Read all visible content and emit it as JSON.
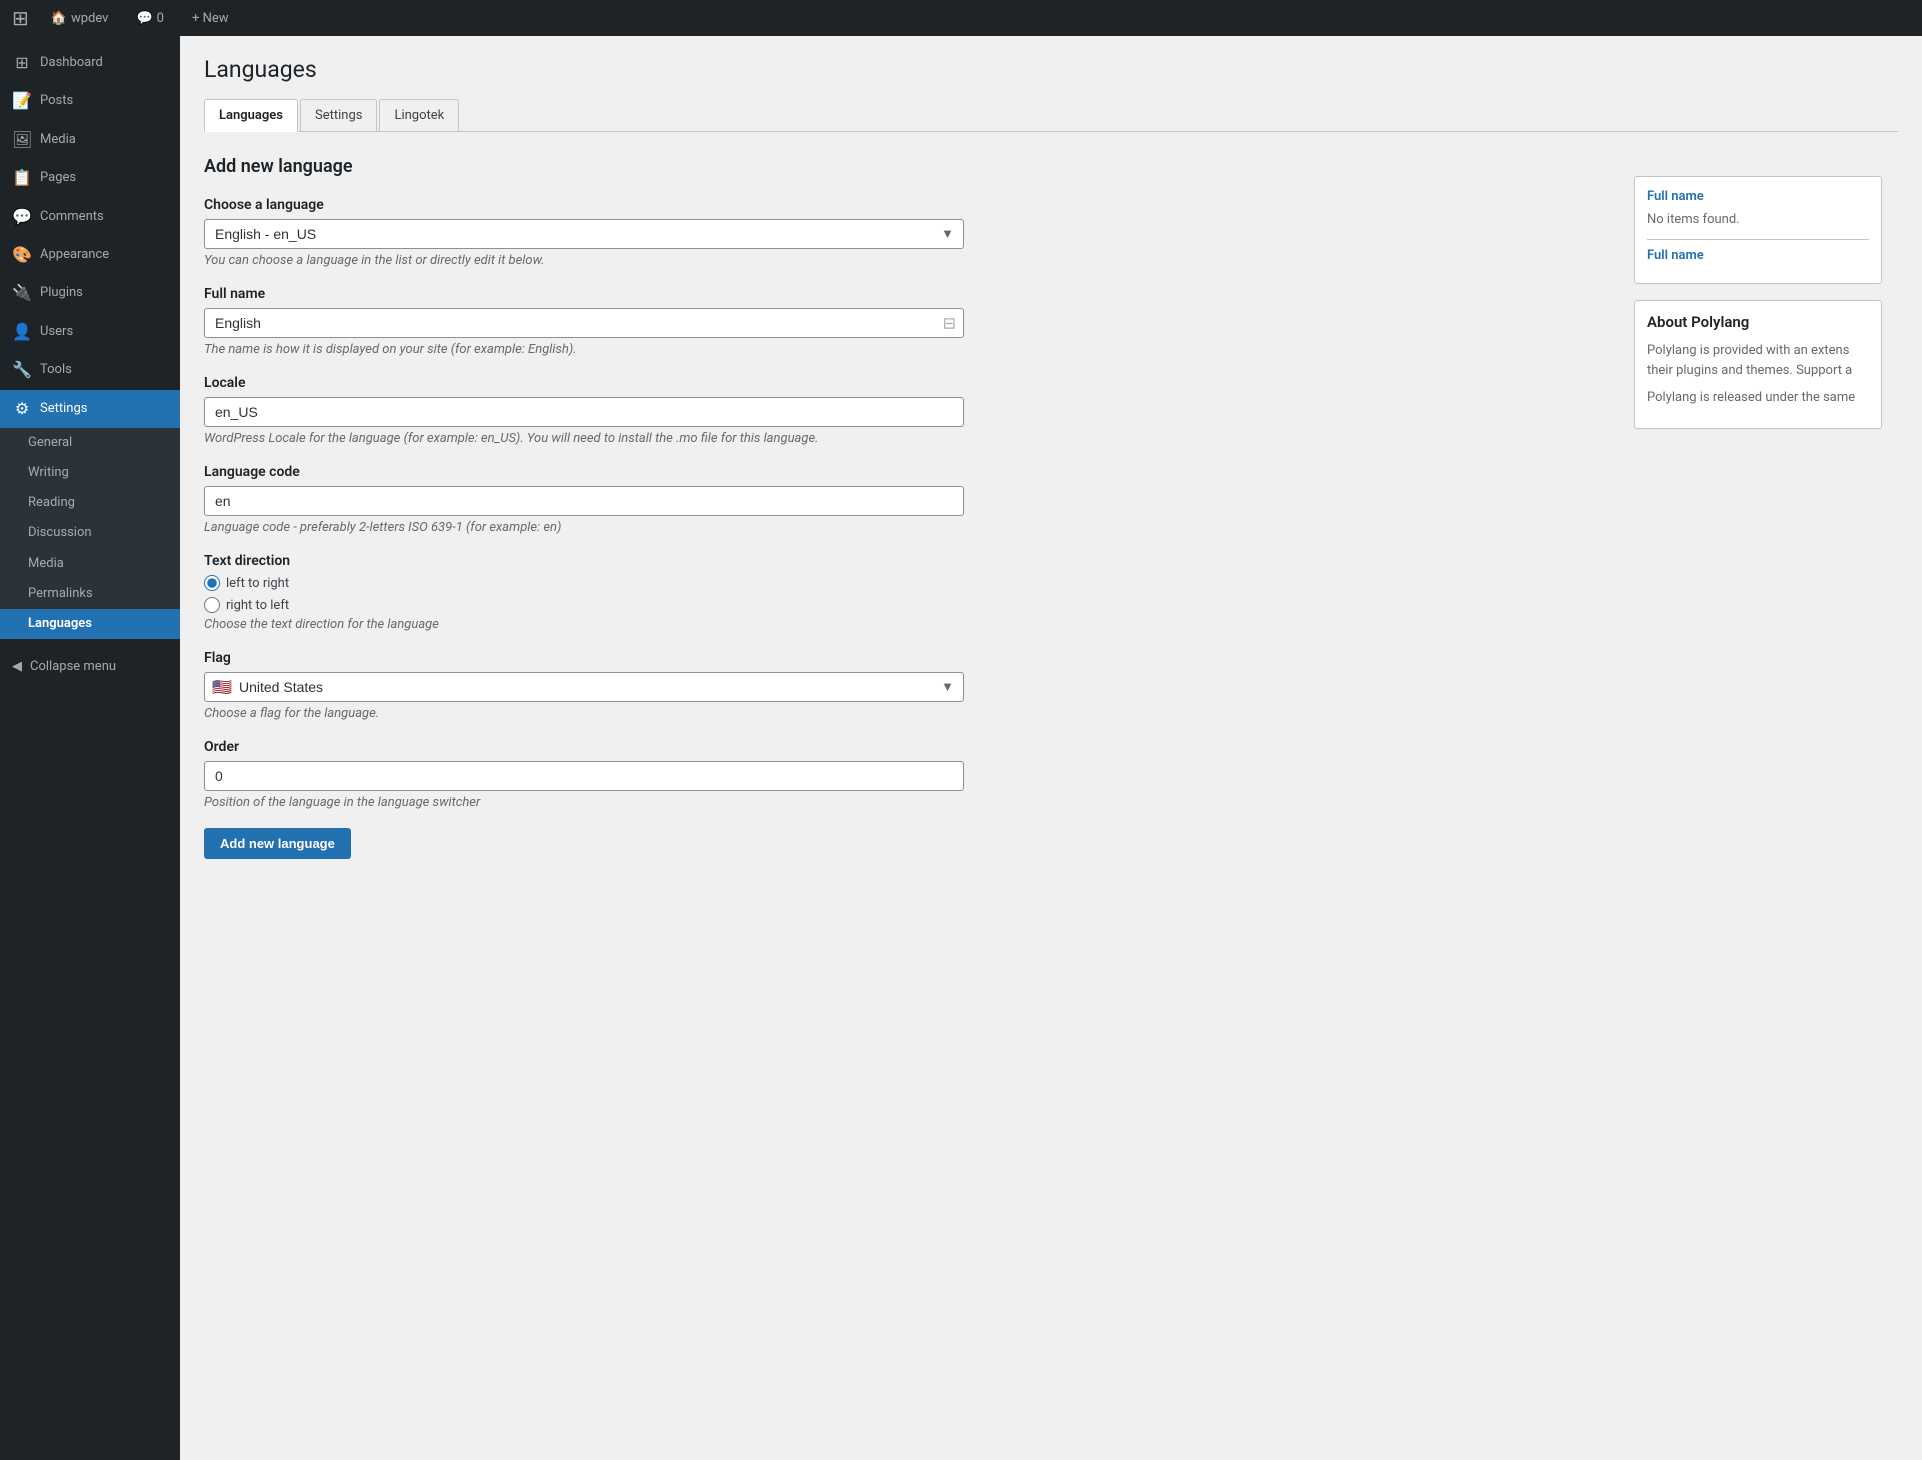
{
  "adminbar": {
    "logo": "⚙",
    "site_name": "wpdev",
    "comments_label": "Comments",
    "comments_count": "0",
    "new_label": "+ New"
  },
  "sidebar": {
    "items": [
      {
        "id": "dashboard",
        "label": "Dashboard",
        "icon": "⊞"
      },
      {
        "id": "posts",
        "label": "Posts",
        "icon": "📄"
      },
      {
        "id": "media",
        "label": "Media",
        "icon": "🖼"
      },
      {
        "id": "pages",
        "label": "Pages",
        "icon": "📋"
      },
      {
        "id": "comments",
        "label": "Comments",
        "icon": "💬"
      },
      {
        "id": "appearance",
        "label": "Appearance",
        "icon": "🎨"
      },
      {
        "id": "plugins",
        "label": "Plugins",
        "icon": "🔌"
      },
      {
        "id": "users",
        "label": "Users",
        "icon": "👤"
      },
      {
        "id": "tools",
        "label": "Tools",
        "icon": "🔧"
      },
      {
        "id": "settings",
        "label": "Settings",
        "icon": "⚙"
      }
    ],
    "settings_submenu": [
      {
        "id": "general",
        "label": "General"
      },
      {
        "id": "writing",
        "label": "Writing"
      },
      {
        "id": "reading",
        "label": "Reading"
      },
      {
        "id": "discussion",
        "label": "Discussion"
      },
      {
        "id": "media",
        "label": "Media"
      },
      {
        "id": "permalinks",
        "label": "Permalinks"
      },
      {
        "id": "languages",
        "label": "Languages"
      }
    ],
    "collapse_label": "Collapse menu"
  },
  "page": {
    "title": "Languages",
    "tabs": [
      {
        "id": "languages",
        "label": "Languages",
        "active": true
      },
      {
        "id": "settings",
        "label": "Settings",
        "active": false
      },
      {
        "id": "lingotek",
        "label": "Lingotek",
        "active": false
      }
    ]
  },
  "form": {
    "section_title": "Add new language",
    "choose_language_label": "Choose a language",
    "choose_language_value": "English - en_US",
    "choose_language_hint": "You can choose a language in the list or directly edit it below.",
    "full_name_label": "Full name",
    "full_name_value": "English",
    "full_name_hint": "The name is how it is displayed on your site (for example: English).",
    "locale_label": "Locale",
    "locale_value": "en_US",
    "locale_hint": "WordPress Locale for the language (for example: en_US). You will need to install the .mo file for this language.",
    "language_code_label": "Language code",
    "language_code_value": "en",
    "language_code_hint": "Language code - preferably 2-letters ISO 639-1 (for example: en)",
    "text_direction_label": "Text direction",
    "text_direction_ltr": "left to right",
    "text_direction_rtl": "right to left",
    "text_direction_hint": "Choose the text direction for the language",
    "flag_label": "Flag",
    "flag_value": "United States",
    "flag_emoji": "🇺🇸",
    "flag_hint": "Choose a flag for the language.",
    "order_label": "Order",
    "order_value": "0",
    "order_hint": "Position of the language in the language switcher",
    "submit_label": "Add new language"
  },
  "widget": {
    "full_name_link": "Full name",
    "no_items": "No items found.",
    "full_name_link2": "Full name",
    "about_title": "About Polylang",
    "about_text1": "Polylang is provided with an extens their plugins and themes. Support a",
    "about_text2": "Polylang is released under the same"
  }
}
